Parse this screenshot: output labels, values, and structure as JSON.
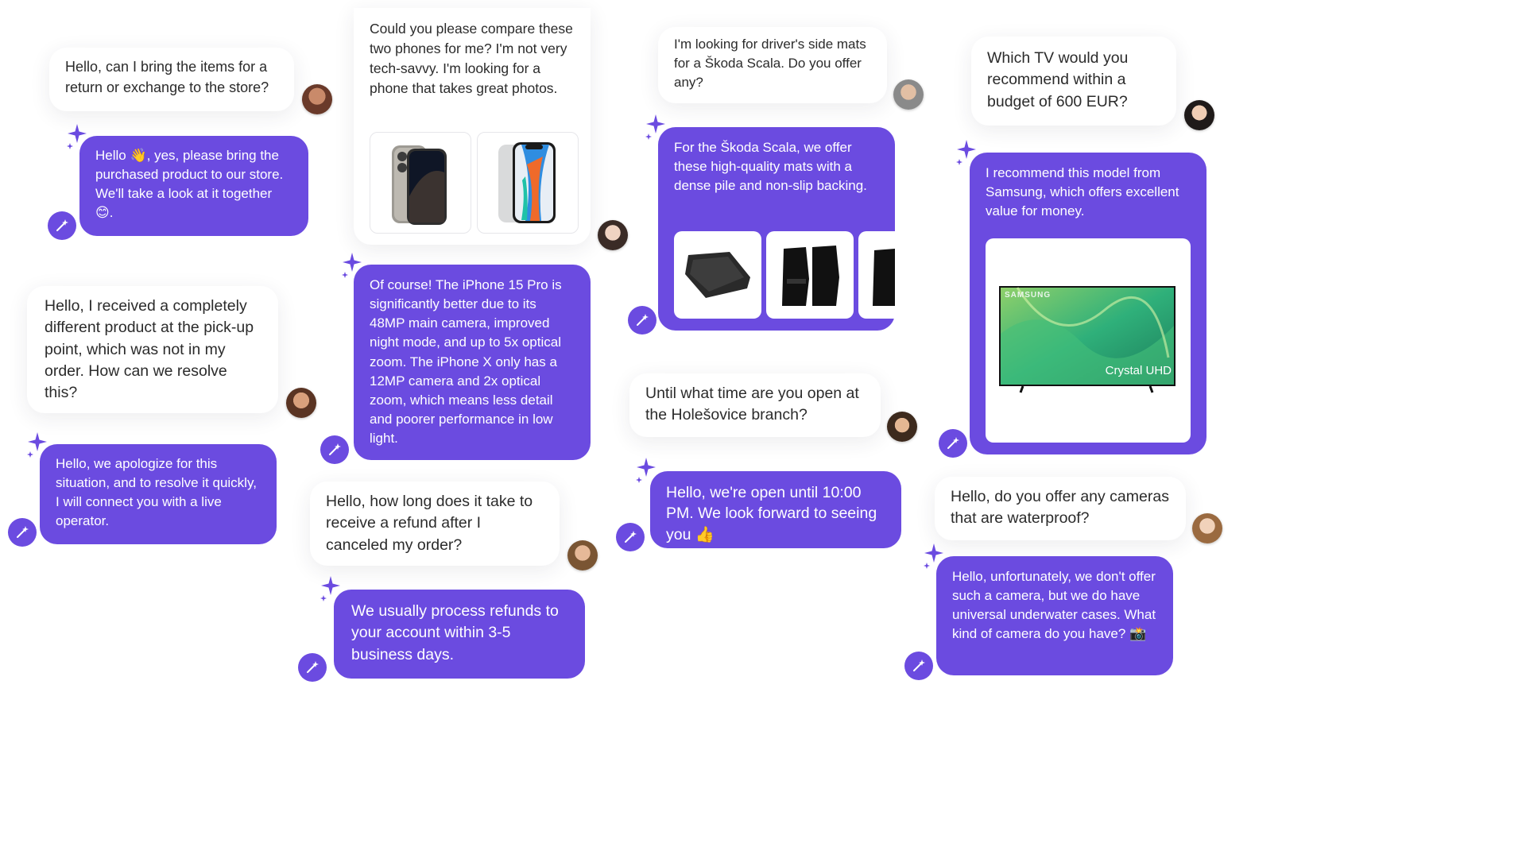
{
  "colors": {
    "bot_bubble": "#6b4be0",
    "customer_bubble": "#ffffff",
    "sparkle": "#6b4be0",
    "text_dark": "#2b2b2b"
  },
  "icons": {
    "bot": "magic-wand-icon",
    "sparkle": "sparkle-icon"
  },
  "conversations": [
    {
      "question": "Hello, can I bring the items for a return or exchange to the store?",
      "answer": "Hello 👋, yes, please bring the purchased product to our store. We'll take a look at it together 😊."
    },
    {
      "question": "Hello, I received a completely different product at the pick-up point, which was not in my order. How can we resolve this?",
      "answer": "Hello, we apologize for this situation, and to resolve it quickly, I will connect you with a live operator."
    },
    {
      "question": "Could you please compare these two phones for me? I'm not very tech-savvy. I'm looking for a phone that takes great photos.",
      "answer": "Of course! The iPhone 15 Pro is significantly better due to its 48MP main camera, improved night mode, and up to 5x optical zoom. The iPhone X only has a 12MP camera and 2x optical zoom, which means less detail and poorer performance in low light."
    },
    {
      "question": "Hello, how long does it take to receive a refund after I canceled my order?",
      "answer": "We usually process refunds to your account within 3-5 business days."
    },
    {
      "question": "I'm looking for driver's side mats for a Škoda Scala. Do you offer any?",
      "answer": "For the Škoda Scala, we offer these high-quality mats with a dense pile and non-slip backing."
    },
    {
      "question": "Until what time are you open at the Holešovice branch?",
      "answer": "Hello, we're open until 10:00 PM. We look forward to seeing you 👍"
    },
    {
      "question": "Which TV would you recommend within a budget of 600 EUR?",
      "answer": "I recommend this model from Samsung, which offers excellent value for money."
    },
    {
      "question": "Hello, do you offer any cameras that are waterproof?",
      "answer": "Hello, unfortunately, we don't offer such a camera, but we do have universal underwater cases. What kind of camera do you have? 📸"
    }
  ],
  "tv": {
    "brand": "SAMSUNG",
    "model_label": "Crystal UHD"
  }
}
